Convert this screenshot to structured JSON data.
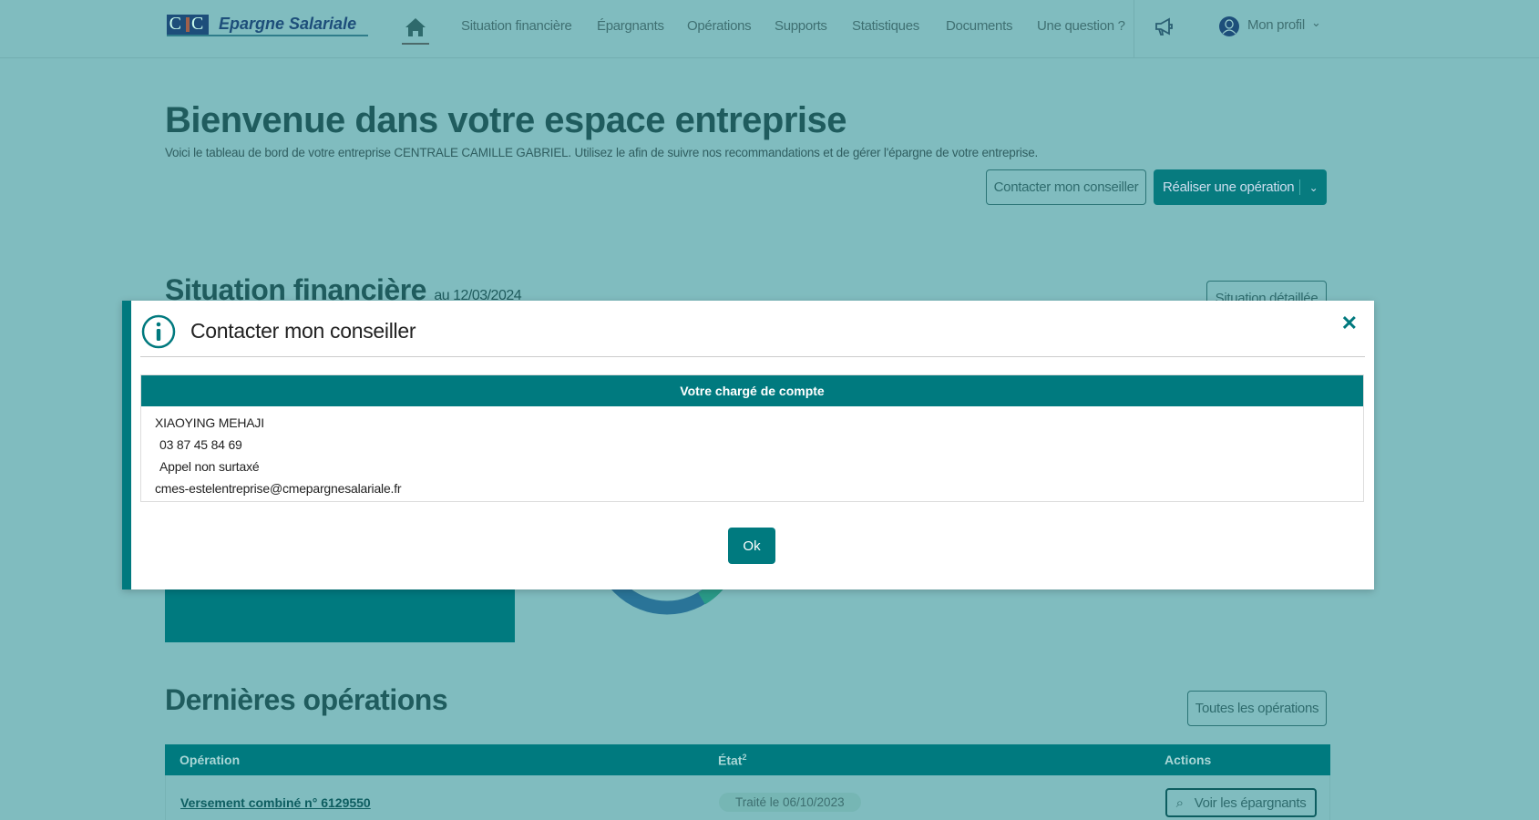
{
  "nav": {
    "logo_mark": "CIC",
    "logo_text": "Epargne Salariale",
    "links": [
      "Situation financière",
      "Épargnants",
      "Opérations",
      "Supports",
      "Statistiques",
      "Documents",
      "Une question ?"
    ],
    "profile": "Mon profil"
  },
  "welcome": {
    "title": "Bienvenue dans votre espace entreprise",
    "subtitle": "Voici le tableau de bord de votre entreprise CENTRALE CAMILLE GABRIEL. Utilisez le afin de suivre nos recommandations et de gérer l'épargne de votre entreprise.",
    "contact_button": "Contacter mon conseiller",
    "operation_button": "Réaliser une opération"
  },
  "situation": {
    "title": "Situation financière",
    "date": "au 12/03/2024",
    "detail_button": "Situation détaillée"
  },
  "operations": {
    "title": "Dernières opérations",
    "all_button": "Toutes les opérations",
    "columns": [
      "Opération",
      "État",
      "Actions"
    ],
    "etat_note": "2",
    "rows": [
      {
        "operation": "Versement combiné n° 6129550",
        "etat": "Traité le 06/10/2023",
        "action": "Voir les épargnants"
      }
    ]
  },
  "modal": {
    "title": "Contacter mon conseiller",
    "table_header": "Votre chargé de compte",
    "name": "XIAOYING MEHAJI",
    "phone": "03 87 45 84 69",
    "phone_note": "Appel non surtaxé",
    "email": "cmes-estelentreprise@cmepargnesalariale.fr",
    "ok_button": "Ok"
  },
  "colors": {
    "accent": "#007a7f",
    "overlay_bg": "#80bcbf"
  }
}
